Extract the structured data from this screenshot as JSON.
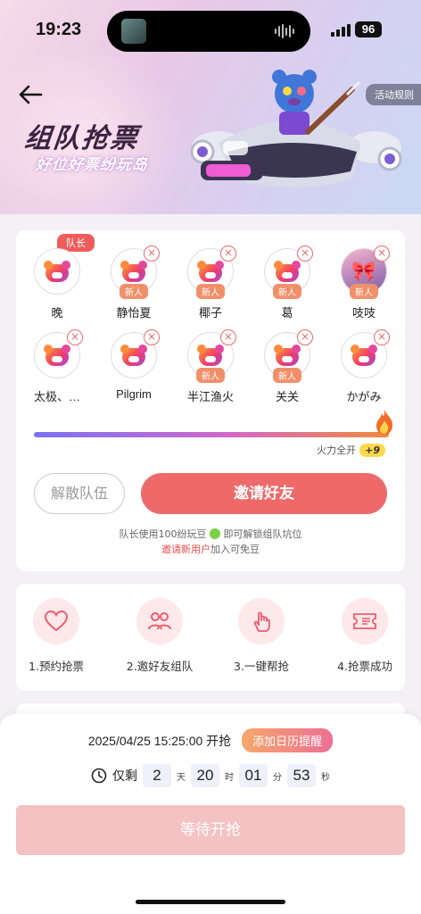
{
  "status_bar": {
    "time": "19:23",
    "battery": "96"
  },
  "banner": {
    "rules_label": "活动规则",
    "title": "组队抢票",
    "subtitle": "好位好票纷玩岛"
  },
  "team": {
    "leader_tag": "队长",
    "new_tag": "新人",
    "members": [
      {
        "name": "晚"
      },
      {
        "name": "静怡夏"
      },
      {
        "name": "椰子"
      },
      {
        "name": "葛"
      },
      {
        "name": "吱吱"
      },
      {
        "name": "太极、…"
      },
      {
        "name": "Pilgrim"
      },
      {
        "name": "半江渔火"
      },
      {
        "name": "关关"
      },
      {
        "name": "かがみ"
      }
    ],
    "fire_progress": 1.0,
    "fire_label": "火力全开",
    "fire_bonus": "+9",
    "dissolve_label": "解散队伍",
    "invite_label": "邀请好友",
    "tip_line1_a": "队长使用100纷玩豆",
    "tip_line1_b": "即可解锁组队坑位",
    "tip_line2_a": "邀请新用户",
    "tip_line2_b": "加入可免豆"
  },
  "steps": [
    {
      "label": "1.预约抢票",
      "icon": "heart-icon"
    },
    {
      "label": "2.邀好友组队",
      "icon": "people-icon"
    },
    {
      "label": "3.一键帮抢",
      "icon": "tap-hand-icon"
    },
    {
      "label": "4.抢票成功",
      "icon": "ticket-icon"
    }
  ],
  "bottom": {
    "start_time": "2025/04/25 15:25:00 开抢",
    "calendar_label": "添加日历提醒",
    "remaining_label": "仅剩",
    "days": "2",
    "days_unit": "天",
    "hours": "20",
    "hours_unit": "时",
    "minutes": "01",
    "minutes_unit": "分",
    "seconds": "53",
    "seconds_unit": "秒",
    "wait_label": "等待开抢"
  },
  "colors": {
    "accent": "#ee6a6a",
    "new_tag": "#f0906a",
    "fire_start": "#7b73f0",
    "fire_end": "#f08a3a"
  }
}
